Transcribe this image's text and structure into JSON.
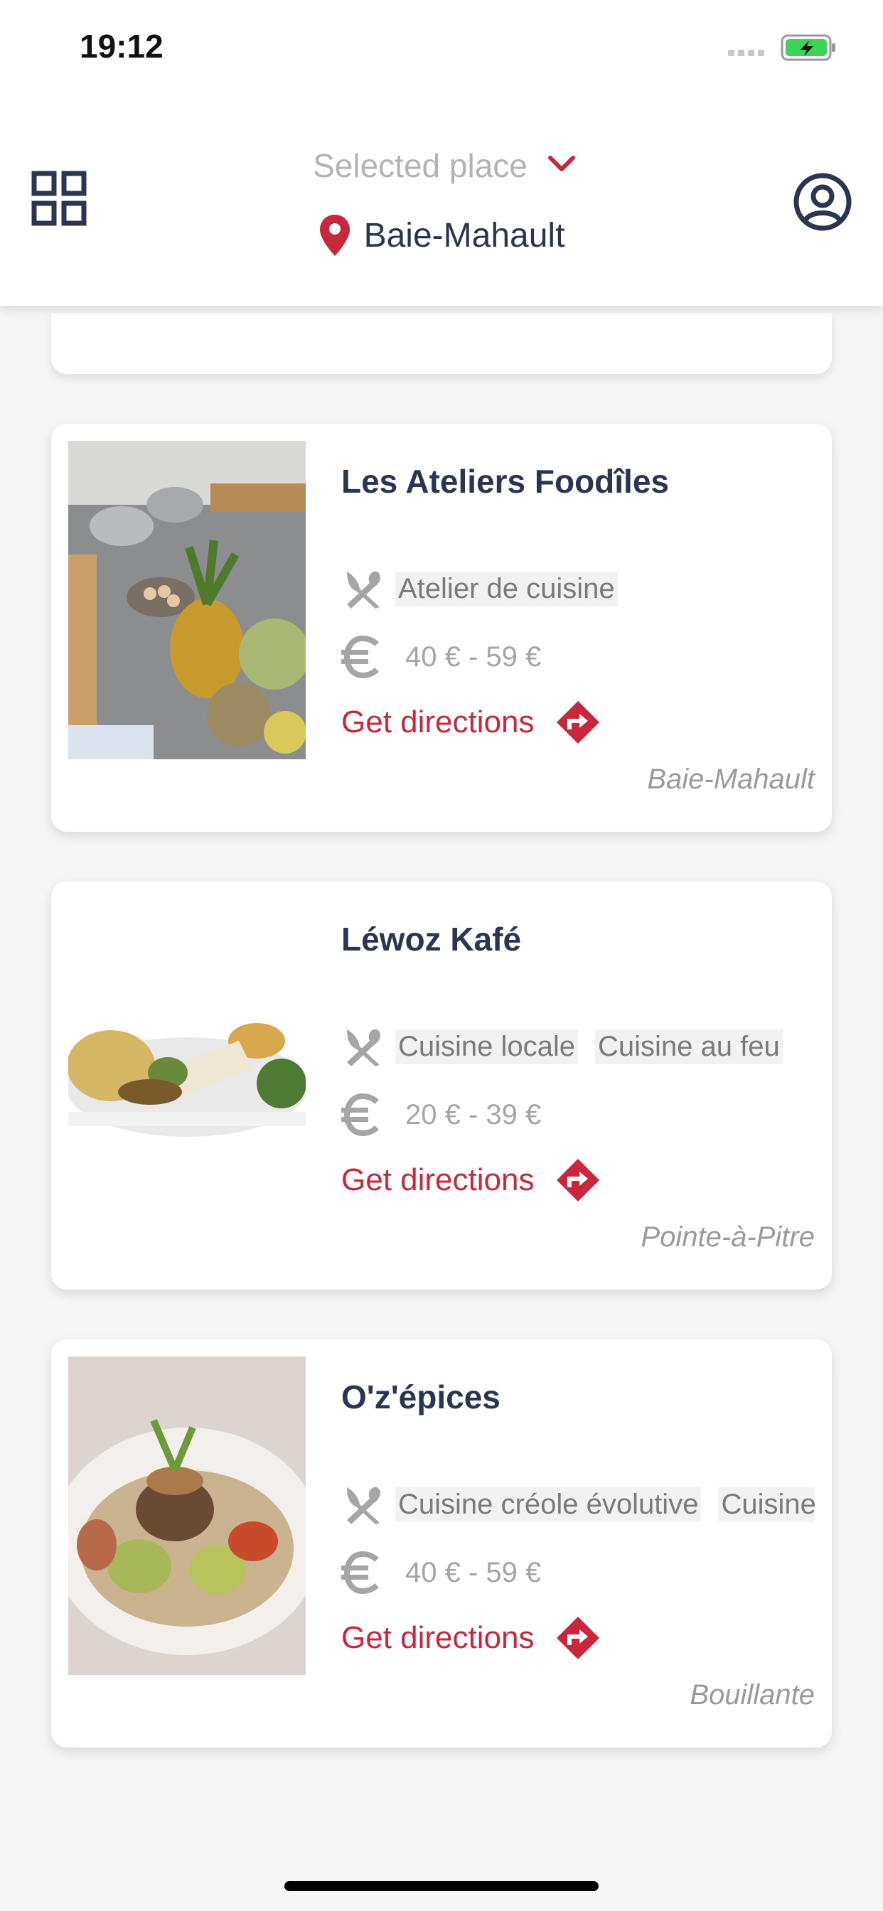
{
  "status_bar": {
    "time": "19:12"
  },
  "header": {
    "place_label": "Selected place",
    "location": "Baie-Mahault"
  },
  "colors": {
    "accent": "#c8283d",
    "navy": "#2b3550",
    "muted": "#a5a5a5",
    "battery": "#3dd25a"
  },
  "restaurants": [
    {
      "name": "Les Ateliers Foodîles",
      "tags": [
        "Atelier de cuisine"
      ],
      "price": "40 € - 59 €",
      "directions_label": "Get directions",
      "city": "Baie-Mahault"
    },
    {
      "name": "Léwoz Kafé",
      "tags": [
        "Cuisine locale",
        "Cuisine au feu"
      ],
      "price": "20 € - 39 €",
      "directions_label": "Get directions",
      "city": "Pointe-à-Pitre"
    },
    {
      "name": "O'z'épices",
      "tags": [
        "Cuisine créole évolutive",
        "Cuisine"
      ],
      "price": "40 € - 59 €",
      "directions_label": "Get directions",
      "city": "Bouillante"
    }
  ]
}
